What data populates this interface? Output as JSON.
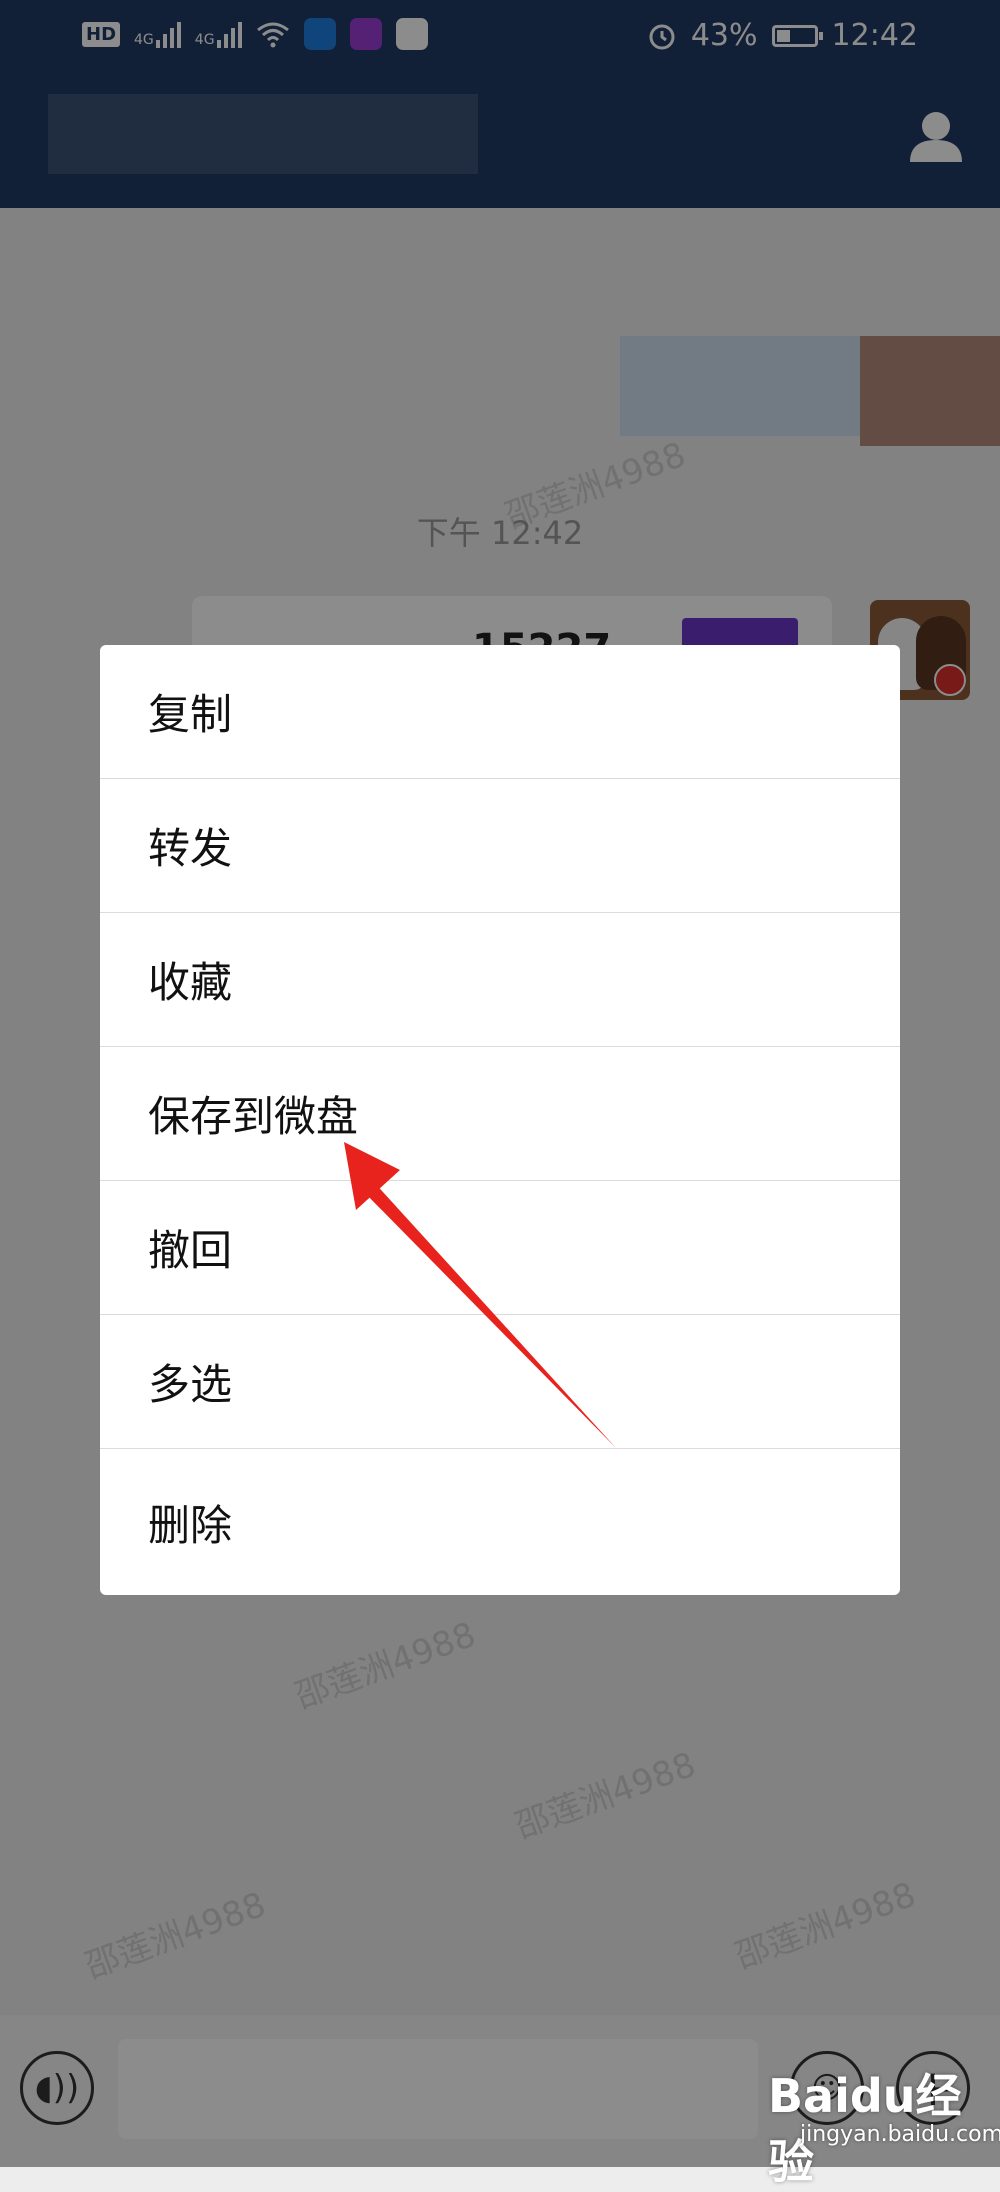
{
  "status_bar": {
    "left_badges": [
      "HD",
      "4G",
      "4G"
    ],
    "battery": "43%",
    "battery_level": 0.43,
    "time": "12:42"
  },
  "chat": {
    "time_label": "下午 12:42",
    "message_partial": "15227",
    "watermark": "邵莲洲4988"
  },
  "menu": {
    "items": [
      {
        "label": "复制"
      },
      {
        "label": "转发"
      },
      {
        "label": "收藏"
      },
      {
        "label": "保存到微盘"
      },
      {
        "label": "撤回"
      },
      {
        "label": "多选"
      },
      {
        "label": "删除"
      }
    ]
  },
  "watermark_brand": {
    "logo": "Baidu经验",
    "url": "jingyan.baidu.com"
  },
  "colors": {
    "header": "#203964",
    "arrow": "#e8231d",
    "bubble_tag": "#6b35c7"
  },
  "icons": {
    "profile": "person-icon",
    "voice": "voice-icon",
    "emoji": "emoji-icon",
    "plus": "plus-icon",
    "alarm": "alarm-icon",
    "wifi": "wifi-icon"
  }
}
